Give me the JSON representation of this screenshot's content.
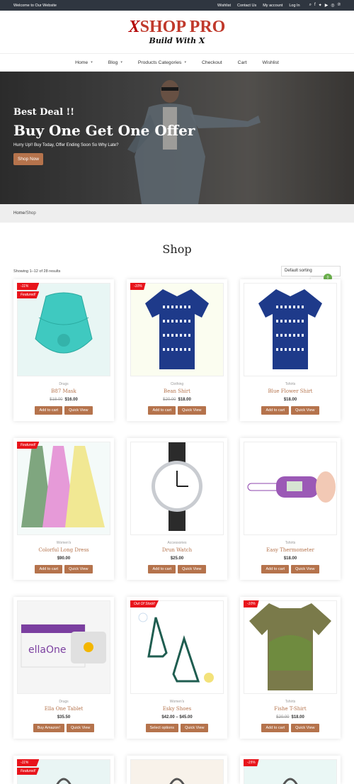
{
  "topbar": {
    "welcome": "Welcome to Our Website",
    "links": [
      "Wishlist",
      "Contact Us",
      "My account",
      "Log In"
    ],
    "icons": [
      "search-icon",
      "facebook-icon",
      "twitter-icon",
      "youtube-icon",
      "instagram-icon",
      "pinterest-icon"
    ]
  },
  "logo": {
    "line1_x": "X",
    "line1_rest": "SHOP PRO",
    "line2": "Build With X"
  },
  "nav": [
    {
      "label": "Home",
      "caret": true
    },
    {
      "label": "Blog",
      "caret": true
    },
    {
      "label": "Products Categories",
      "caret": true
    },
    {
      "label": "Checkout",
      "caret": false
    },
    {
      "label": "Cart",
      "caret": false
    },
    {
      "label": "Wishlist",
      "caret": false
    }
  ],
  "hero": {
    "kicker": "Best Deal !!",
    "title": "Buy One Get One Offer",
    "subtitle": "Hurry Up!! Buy Today, Offer Ending Soon So Why Late?",
    "button": "Shop Now"
  },
  "breadcrumb": {
    "home": "Home",
    "sep": " / ",
    "current": "Shop"
  },
  "shop": {
    "title": "Shop",
    "result_count": "Showing 1–12 of 28 results",
    "sort": "Default sorting",
    "cart_count": "0"
  },
  "products": [
    {
      "badges": [
        "-11%",
        "Featured!"
      ],
      "category": "Drugs",
      "name": "B87 Mask",
      "old_price": "$18.00",
      "price": "$16.00",
      "btn1": "Add to cart",
      "btn2": "Quick View",
      "icon": "mask-icon"
    },
    {
      "badges": [
        "-10%"
      ],
      "category": "Clothing",
      "name": "Bean Shirt",
      "old_price": "$20.00",
      "price": "$18.00",
      "btn1": "Add to cart",
      "btn2": "Quick View",
      "icon": "shirt-icon"
    },
    {
      "badges": [],
      "category": "Tshirts",
      "name": "Blue Flower Shirt",
      "old_price": "",
      "price": "$18.00",
      "btn1": "Add to cart",
      "btn2": "Quick View",
      "icon": "shirt-icon"
    },
    {
      "badges": [
        "Featured!"
      ],
      "category": "Women's",
      "name": "Colorful Long Dress",
      "old_price": "",
      "price": "$90.00",
      "btn1": "Add to cart",
      "btn2": "Quick View",
      "icon": "dress-icon"
    },
    {
      "badges": [],
      "category": "Accessories",
      "name": "Drun Watch",
      "old_price": "",
      "price": "$25.00",
      "btn1": "Add to cart",
      "btn2": "Quick View",
      "icon": "watch-icon"
    },
    {
      "badges": [],
      "category": "Tshirts",
      "name": "Easy Thermometer",
      "old_price": "",
      "price": "$18.00",
      "btn1": "Add to cart",
      "btn2": "Quick View",
      "icon": "thermometer-icon"
    },
    {
      "badges": [],
      "category": "Drugs",
      "name": "Ella One Tablet",
      "old_price": "",
      "price": "$35.50",
      "btn1": "Buy Amazon!",
      "btn2": "Quick View",
      "icon": "tablet-box-icon"
    },
    {
      "badges": [
        "Out Of Stock!"
      ],
      "category": "Women's",
      "name": "Esky Shoes",
      "old_price": "",
      "price": "$42.00 – $45.00",
      "btn1": "Select options",
      "btn2": "Quick View",
      "icon": "shoes-icon"
    },
    {
      "badges": [
        "-10%"
      ],
      "category": "Tshirts",
      "name": "Fishe T-Shirt",
      "old_price": "$20.00",
      "price": "$18.00",
      "btn1": "Add to cart",
      "btn2": "Quick View",
      "icon": "tshirt-icon"
    },
    {
      "badges": [
        "-11%",
        "Featured!"
      ],
      "partial": true,
      "icon": "bag-icon"
    },
    {
      "badges": [],
      "partial": true,
      "icon": "bag-icon"
    },
    {
      "badges": [
        "-15%"
      ],
      "partial": true,
      "icon": "bag-icon"
    }
  ]
}
